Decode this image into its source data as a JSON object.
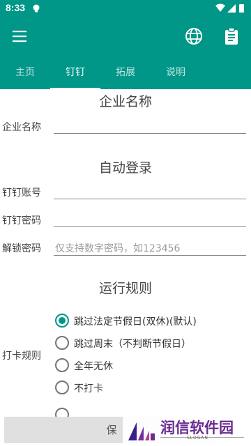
{
  "status_bar": {
    "time": "8:33"
  },
  "app_bar": {
    "menu_icon": "menu-icon",
    "globe_icon": "globe-icon",
    "clipboard_icon": "clipboard-icon"
  },
  "tabs": [
    {
      "label": "主页"
    },
    {
      "label": "钉钉"
    },
    {
      "label": "拓展"
    },
    {
      "label": "说明"
    }
  ],
  "sections": {
    "company": {
      "title": "企业名称",
      "label": "企业名称",
      "value": ""
    },
    "auto_login": {
      "title": "自动登录",
      "account_label": "钉钉账号",
      "account_value": "",
      "password_label": "钉钉密码",
      "password_value": "",
      "unlock_label": "解锁密码",
      "unlock_placeholder": "仅支持数字密码，如123456"
    },
    "rules": {
      "title": "运行规则",
      "label": "打卡规则",
      "options": [
        {
          "label": "跳过法定节假日(双休)(默认)",
          "checked": true
        },
        {
          "label": "跳过周末（不判断节假日）",
          "checked": false
        },
        {
          "label": "全年无休",
          "checked": false
        },
        {
          "label": "不打卡",
          "checked": false
        }
      ]
    }
  },
  "save_button": {
    "label": "保"
  },
  "watermark": {
    "text": "润信软件园",
    "slogan": "SLOGAN"
  },
  "colors": {
    "primary": "#009688",
    "indicator": "#ffffff"
  }
}
